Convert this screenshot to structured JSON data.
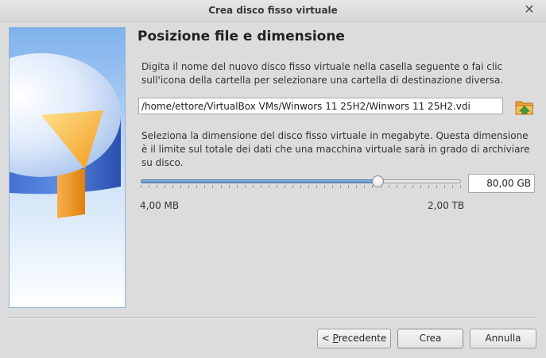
{
  "window": {
    "title": "Crea disco fisso virtuale",
    "close_icon": "close-icon"
  },
  "heading": "Posizione file e dimensione",
  "location": {
    "description": "Digita il nome del nuovo disco fisso virtuale nella casella seguente o fai clic sull'icona della cartella per selezionare una cartella di destinazione diversa.",
    "path": "/home/ettore/VirtualBox VMs/Winwors 11 25H2/Winwors 11 25H2.vdi",
    "folder_icon": "folder-open-icon"
  },
  "size": {
    "description": "Seleziona la dimensione del disco fisso virtuale in megabyte. Questa dimensione è il limite sul totale dei dati che una macchina virtuale sarà in grado di archiviare su disco.",
    "value": "80,00 GB",
    "min_label": "4,00 MB",
    "max_label": "2,00 TB",
    "slider_fraction": 0.74
  },
  "buttons": {
    "back_prefix": "< ",
    "back_accel": "P",
    "back_rest": "recedente",
    "create": "Crea",
    "cancel": "Annulla"
  },
  "colors": {
    "accent": "#5f93c4",
    "side_art_blue": "#3f6fd0",
    "side_art_orange": "#f7a32a"
  }
}
